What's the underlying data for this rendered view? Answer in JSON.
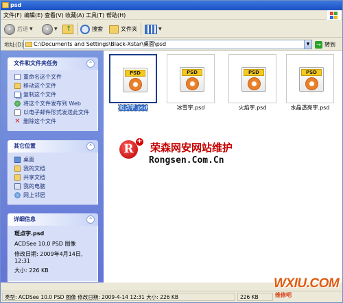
{
  "window": {
    "title": "psd"
  },
  "menu": {
    "items": [
      "文件(F)",
      "编辑(E)",
      "查看(V)",
      "收藏(A)",
      "工具(T)",
      "帮助(H)"
    ]
  },
  "toolbar": {
    "back_label": "后退",
    "search_label": "搜索",
    "folders_label": "文件夹",
    "views_icon": "views-grid-icon"
  },
  "address": {
    "label": "地址(D)",
    "path": "C:\\Documents and Settings\\Black-Xstar\\桌面\\psd",
    "go_label": "转到"
  },
  "tasks_panel": {
    "title": "文件和文件夹任务",
    "items": [
      {
        "label": "重命名这个文件",
        "icon": "rename-icon"
      },
      {
        "label": "移动这个文件",
        "icon": "move-icon"
      },
      {
        "label": "复制这个文件",
        "icon": "copy-icon"
      },
      {
        "label": "将这个文件发布到 Web",
        "icon": "publish-web-icon"
      },
      {
        "label": "以电子邮件形式发送此文件",
        "icon": "email-icon"
      },
      {
        "label": "删除这个文件",
        "icon": "delete-icon"
      }
    ]
  },
  "places_panel": {
    "title": "其它位置",
    "items": [
      {
        "label": "桌面",
        "icon": "desktop-icon"
      },
      {
        "label": "我的文档",
        "icon": "documents-folder-icon"
      },
      {
        "label": "共享文档",
        "icon": "shared-folder-icon"
      },
      {
        "label": "我的电脑",
        "icon": "computer-icon"
      },
      {
        "label": "网上邻居",
        "icon": "network-icon"
      }
    ]
  },
  "details_panel": {
    "title": "详细信息",
    "name": "斑点字.psd",
    "type": "ACDSee 10.0 PSD 图像",
    "modified": "修改日期: 2009年4月14日, 12:31",
    "size": "大小: 226 KB"
  },
  "files": [
    {
      "name": "斑点字.psd",
      "badge": "PSD",
      "selected": true
    },
    {
      "name": "冰雪字.psd",
      "badge": "PSD",
      "selected": false
    },
    {
      "name": "火焰字.psd",
      "badge": "PSD",
      "selected": false
    },
    {
      "name": "水晶透亮字.psd",
      "badge": "PSD",
      "selected": false
    }
  ],
  "watermark": {
    "logo_letter": "R",
    "plus": "+",
    "cn": "荣森网安网站维护",
    "en": "Rongsen.Com.Cn"
  },
  "status": {
    "info": "类型: ACDSee 10.0 PSD 图像 修改日期: 2009-4-14 12:31 大小: 226 KB",
    "size": "226 KB"
  },
  "corner_watermark": {
    "main": "WXIU.COM",
    "sub": "维修吧"
  },
  "colors": {
    "title_bar": "#1b4fc4",
    "left_pane": "#6375d6",
    "selection": "#316ac5",
    "watermark_red": "#c40000",
    "corner_orange": "#e05a10"
  }
}
